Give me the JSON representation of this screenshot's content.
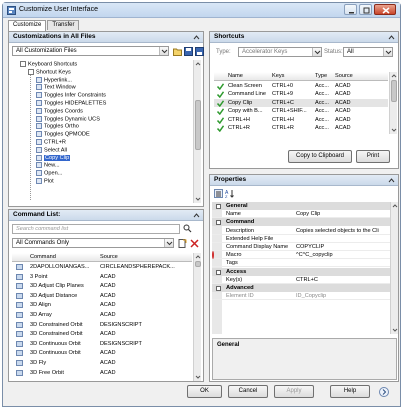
{
  "window": {
    "title": "Customize User Interface"
  },
  "tabs": [
    {
      "label": "Customize"
    },
    {
      "label": "Transfer"
    }
  ],
  "customizations": {
    "header": "Customizations in All Files",
    "file_select": "All Customization Files",
    "tree": [
      {
        "label": "Keyboard Shortcuts",
        "level": 1
      },
      {
        "label": "Shortcut Keys",
        "level": 2
      },
      {
        "label": "Hyperlink...",
        "level": 3
      },
      {
        "label": "Text Window",
        "level": 3
      },
      {
        "label": "Toggles Infer Constraints",
        "level": 3
      },
      {
        "label": "Toggles HIDEPALETTES",
        "level": 3
      },
      {
        "label": "Toggles Coords",
        "level": 3
      },
      {
        "label": "Toggles Dynamic UCS",
        "level": 3
      },
      {
        "label": "Toggles Ortho",
        "level": 3
      },
      {
        "label": "Toggles QPMODE",
        "level": 3
      },
      {
        "label": "CTRL+R",
        "level": 3
      },
      {
        "label": "Select All",
        "level": 3
      },
      {
        "label": "Copy Clip",
        "level": 3,
        "selected": true
      },
      {
        "label": "New...",
        "level": 3
      },
      {
        "label": "Open...",
        "level": 3
      },
      {
        "label": "Plot",
        "level": 3
      }
    ]
  },
  "command_list": {
    "header": "Command List:",
    "search_placeholder": "Search command list",
    "filter": "All Commands Only",
    "columns": {
      "command": "Command",
      "source": "Source"
    },
    "rows": [
      {
        "command": "2DAPOLLONIANGAS...",
        "source": "CIRCLEANDSPHEREPACK..."
      },
      {
        "command": "3 Point",
        "source": "ACAD"
      },
      {
        "command": "3D Adjust Clip Planes",
        "source": "ACAD"
      },
      {
        "command": "3D Adjust Distance",
        "source": "ACAD"
      },
      {
        "command": "3D Align",
        "source": "ACAD"
      },
      {
        "command": "3D Array",
        "source": "ACAD"
      },
      {
        "command": "3D Constrained Orbit",
        "source": "DESIGNSCRIPT"
      },
      {
        "command": "3D Constrained Orbit",
        "source": "ACAD"
      },
      {
        "command": "3D Continuous Orbit",
        "source": "DESIGNSCRIPT"
      },
      {
        "command": "3D Continuous Orbit",
        "source": "ACAD"
      },
      {
        "command": "3D Fly",
        "source": "ACAD"
      },
      {
        "command": "3D Free Orbit",
        "source": "ACAD"
      }
    ]
  },
  "shortcuts": {
    "header": "Shortcuts",
    "type_label": "Type:",
    "type_value": "Accelerator Keys",
    "status_label": "Status:",
    "status_value": "All",
    "columns": {
      "name": "Name",
      "keys": "Keys",
      "type": "Type",
      "source": "Source"
    },
    "rows": [
      {
        "name": "Clean Screen",
        "keys": "CTRL+0",
        "type": "Acc...",
        "source": "ACAD"
      },
      {
        "name": "Command Line",
        "keys": "CTRL+9",
        "type": "Acc...",
        "source": "ACAD"
      },
      {
        "name": "Copy Clip",
        "keys": "CTRL+C",
        "type": "Acc...",
        "source": "ACAD",
        "selected": true
      },
      {
        "name": "Copy with B...",
        "keys": "CTRL+SHIF...",
        "type": "Acc...",
        "source": "ACAD"
      },
      {
        "name": "CTRL+H",
        "keys": "CTRL+H",
        "type": "Acc...",
        "source": "ACAD"
      },
      {
        "name": "CTRL+R",
        "keys": "CTRL+R",
        "type": "Acc...",
        "source": "ACAD"
      }
    ],
    "copy_button": "Copy to Clipboard",
    "print_button": "Print"
  },
  "properties": {
    "header": "Properties",
    "categories": [
      {
        "title": "General",
        "rows": [
          {
            "key": "Name",
            "value": "Copy Clip"
          }
        ]
      },
      {
        "title": "Command",
        "rows": [
          {
            "key": "Description",
            "value": "Copies selected objects to the Cli"
          },
          {
            "key": "Extended Help File",
            "value": ""
          },
          {
            "key": "Command Display Name",
            "value": "COPYCLIP"
          },
          {
            "key": "Macro",
            "value": "^C^C_copyclip"
          },
          {
            "key": "Tags",
            "value": ""
          }
        ]
      },
      {
        "title": "Access",
        "rows": [
          {
            "key": "Key(s)",
            "value": "CTRL+C"
          }
        ]
      },
      {
        "title": "Advanced",
        "rows": [
          {
            "key": "Element ID",
            "value": "ID_Copyclip"
          }
        ]
      }
    ],
    "help_section": "General"
  },
  "footer": {
    "ok": "OK",
    "cancel": "Cancel",
    "apply": "Apply",
    "help": "Help"
  },
  "colors": {
    "selection": "#3366cc",
    "check": "#2e9a2e",
    "highlight_ring": "#d03030"
  }
}
